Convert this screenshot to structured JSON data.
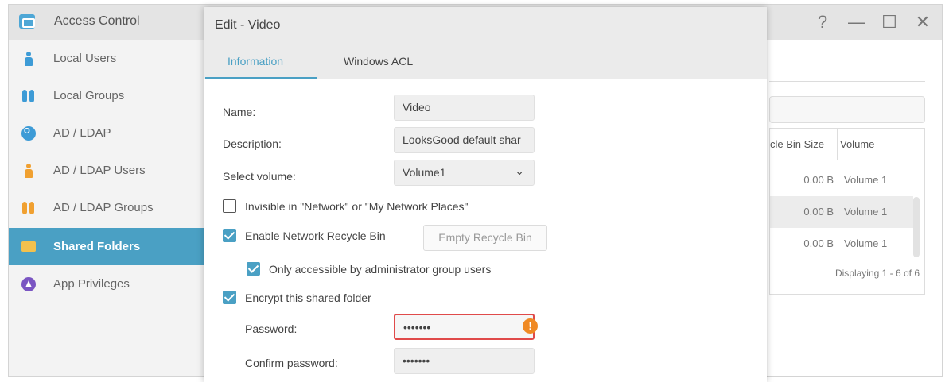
{
  "app": {
    "title": "Access Control",
    "icon": "access-control-icon",
    "controls": {
      "help": "?",
      "minimize": "—",
      "maximize": "☐",
      "close": "✕"
    }
  },
  "sidebar": {
    "items": [
      {
        "label": "Local Users",
        "icon": "user-icon"
      },
      {
        "label": "Local Groups",
        "icon": "group-icon"
      },
      {
        "label": "AD / LDAP",
        "icon": "ad-ldap-icon"
      },
      {
        "label": "AD / LDAP Users",
        "icon": "ad-user-icon"
      },
      {
        "label": "AD / LDAP Groups",
        "icon": "ad-group-icon"
      },
      {
        "label": "Shared Folders",
        "icon": "folder-icon",
        "active": true
      },
      {
        "label": "App Privileges",
        "icon": "privilege-icon"
      }
    ]
  },
  "background_table": {
    "headers": [
      "cle Bin Size",
      "Volume"
    ],
    "rows": [
      {
        "size": "0.00 B",
        "volume": "Volume 1"
      },
      {
        "size": "0.00 B",
        "volume": "Volume 1"
      },
      {
        "size": "0.00 B",
        "volume": "Volume 1"
      }
    ],
    "footer": "Displaying 1 - 6 of 6"
  },
  "dialog": {
    "title": "Edit - Video",
    "tabs": [
      {
        "label": "Information",
        "active": true
      },
      {
        "label": "Windows ACL"
      }
    ],
    "fields": {
      "name": {
        "label": "Name:",
        "value": "Video"
      },
      "description": {
        "label": "Description:",
        "value": "LooksGood default shar"
      },
      "volume": {
        "label": "Select volume:",
        "value": "Volume1"
      },
      "password": {
        "label": "Password:",
        "value": "•••••••"
      },
      "confirm_password": {
        "label": "Confirm password:",
        "value": "•••••••"
      }
    },
    "checkboxes": {
      "invisible": {
        "label": "Invisible in \"Network\" or \"My Network Places\"",
        "checked": false
      },
      "recycle_bin": {
        "label": "Enable Network Recycle Bin",
        "checked": true
      },
      "admin_only": {
        "label": "Only accessible by administrator group users",
        "checked": true
      },
      "encrypt": {
        "label": "Encrypt this shared folder",
        "checked": true
      }
    },
    "empty_recycle_bin": "Empty Recycle Bin",
    "alert_glyph": "!"
  },
  "colors": {
    "accent": "#4aa0c4",
    "error": "#e04a4a",
    "warning": "#f08a24"
  }
}
